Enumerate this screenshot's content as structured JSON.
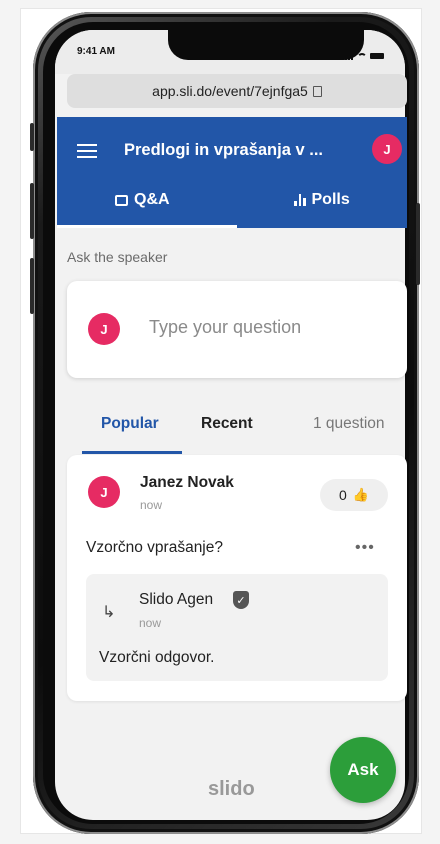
{
  "status_bar": {
    "time": "9:41 AM"
  },
  "browser": {
    "url": "app.sli.do/event/7ejnfga5"
  },
  "header": {
    "title": "Predlogi in vprašanja v ...",
    "avatar_initial": "J",
    "tabs": [
      {
        "label": "Q&A",
        "icon": "chat-icon",
        "active": true
      },
      {
        "label": "Polls",
        "icon": "bar-chart-icon",
        "active": false
      }
    ]
  },
  "ask_section": {
    "label": "Ask the speaker",
    "avatar_initial": "J",
    "placeholder": "Type your question"
  },
  "list_tabs": {
    "popular": "Popular",
    "recent": "Recent",
    "count": "1 question"
  },
  "question": {
    "author": "Janez Novak",
    "avatar_initial": "J",
    "time": "now",
    "likes": "0",
    "text": "Vzorčno vprašanje?",
    "more": "•••",
    "reply": {
      "author": "Slido Agen",
      "time": "now",
      "text": "Vzorčni odgovor."
    }
  },
  "footer": {
    "brand": "slido",
    "ask_button": "Ask"
  },
  "colors": {
    "header_blue": "#2256a8",
    "avatar_pink": "#e62b63",
    "fab_green": "#2c9e3a"
  }
}
